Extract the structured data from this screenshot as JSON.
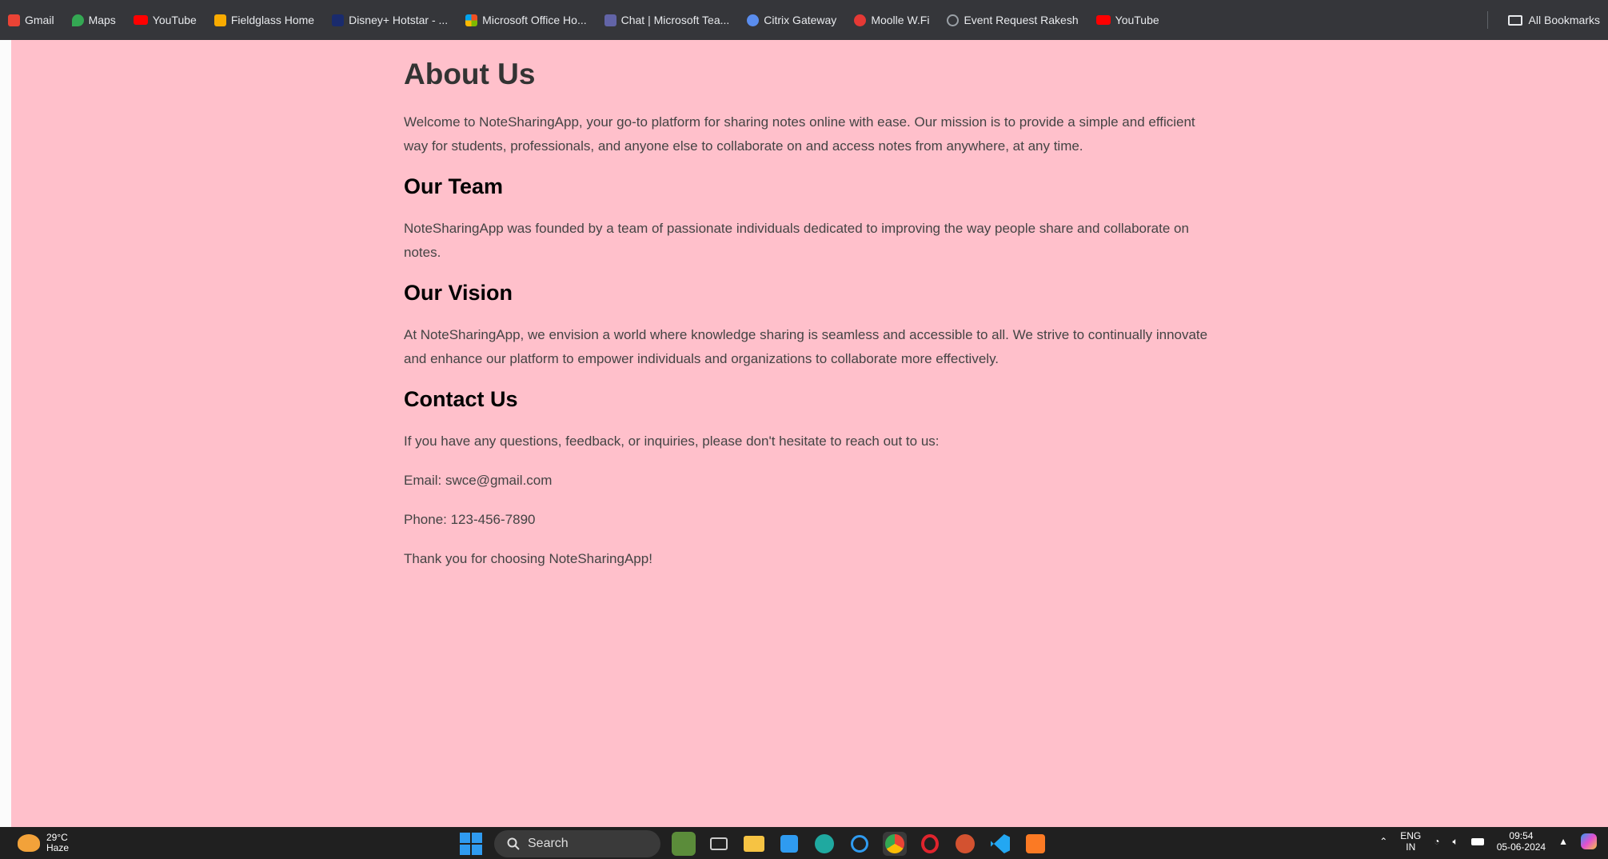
{
  "bookmarks": [
    {
      "label": "Gmail",
      "icon": "gmail-icon",
      "color": "#ea4335"
    },
    {
      "label": "Maps",
      "icon": "maps-icon",
      "color": "#34a853"
    },
    {
      "label": "YouTube",
      "icon": "youtube-icon",
      "color": "#ff0000"
    },
    {
      "label": "Fieldglass Home",
      "icon": "fieldglass-icon",
      "color": "#f9ab00"
    },
    {
      "label": "Disney+ Hotstar - ...",
      "icon": "hotstar-icon",
      "color": "#1a2b6d"
    },
    {
      "label": "Microsoft Office Ho...",
      "icon": "office-icon",
      "color": "#f25022"
    },
    {
      "label": "Chat | Microsoft Tea...",
      "icon": "teams-icon",
      "color": "#6264a7"
    },
    {
      "label": "Citrix Gateway",
      "icon": "citrix-icon",
      "color": "#5a8dee"
    },
    {
      "label": "Moolle W.Fi",
      "icon": "wifi-bookmark-icon",
      "color": "#e53935"
    },
    {
      "label": "Event Request Rakesh",
      "icon": "globe-icon",
      "color": "#9aa0a6"
    },
    {
      "label": "YouTube",
      "icon": "youtube-icon",
      "color": "#ff0000"
    }
  ],
  "all_bookmarks_label": "All Bookmarks",
  "page": {
    "background": "#ffc0cb",
    "title": "About Us",
    "intro": "Welcome to NoteSharingApp, your go-to platform for sharing notes online with ease. Our mission is to provide a simple and efficient way for students, professionals, and anyone else to collaborate on and access notes from anywhere, at any time.",
    "team_heading": "Our Team",
    "team_text": "NoteSharingApp was founded by a team of passionate individuals dedicated to improving the way people share and collaborate on notes.",
    "vision_heading": "Our Vision",
    "vision_text": "At NoteSharingApp, we envision a world where knowledge sharing is seamless and accessible to all. We strive to continually innovate and enhance our platform to empower individuals and organizations to collaborate more effectively.",
    "contact_heading": "Contact Us",
    "contact_text": "If you have any questions, feedback, or inquiries, please don't hesitate to reach out to us:",
    "email": "Email: swce@gmail.com",
    "phone": "Phone: 123-456-7890",
    "thanks": "Thank you for choosing NoteSharingApp!"
  },
  "taskbar": {
    "weather_temp": "29°C",
    "weather_desc": "Haze",
    "search_placeholder": "Search",
    "lang_top": "ENG",
    "lang_bottom": "IN",
    "time": "09:54",
    "date": "05-06-2024"
  }
}
